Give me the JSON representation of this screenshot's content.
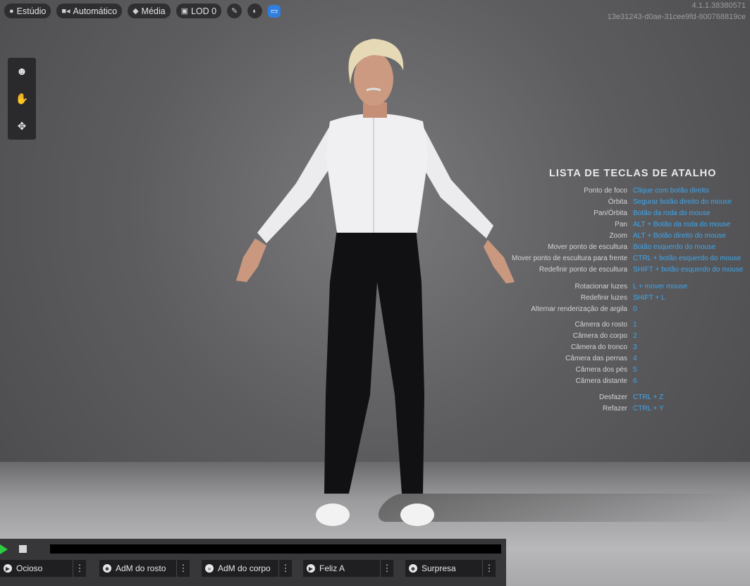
{
  "toolbar": {
    "studio": "Estúdio",
    "auto": "Automático",
    "quality": "Média",
    "lod": "LOD 0"
  },
  "version": {
    "line1": "4.1.1.38380571",
    "line2": "13e31243-d0ae-31cee9fd-800768819ce"
  },
  "shortcuts": {
    "title": "LISTA DE TECLAS DE ATALHO",
    "groups": [
      [
        {
          "label": "Ponto de foco",
          "key": "Clique com botão direito"
        },
        {
          "label": "Órbita",
          "key": "Segurar botão direito do mouse"
        },
        {
          "label": "Pan/Órbita",
          "key": "Botão da roda do mouse"
        },
        {
          "label": "Pan",
          "key": "ALT + Botão da roda do mouse"
        },
        {
          "label": "Zoom",
          "key": "ALT + Botão direito do mouse"
        },
        {
          "label": "Mover ponto de escultura",
          "key": "Botão esquerdo do mouse"
        },
        {
          "label": "Mover ponto de escultura para frente",
          "key": "CTRL + botão esquerdo do mouse"
        },
        {
          "label": "Redefinir ponto de escultura",
          "key": "SHIFT + botão esquerdo do mouse"
        }
      ],
      [
        {
          "label": "Rotacionar luzes",
          "key": "L + mover mouse"
        },
        {
          "label": "Redefinir luzes",
          "key": "SHIFT + L"
        },
        {
          "label": "Alternar renderização de argila",
          "key": "0"
        }
      ],
      [
        {
          "label": "Câmera do rosto",
          "key": "1"
        },
        {
          "label": "Câmera do corpo",
          "key": "2"
        },
        {
          "label": "Câmera do tronco",
          "key": "3"
        },
        {
          "label": "Câmera das pernas",
          "key": "4"
        },
        {
          "label": "Câmera dos pés",
          "key": "5"
        },
        {
          "label": "Câmera distante",
          "key": "6"
        }
      ],
      [
        {
          "label": "Desfazer",
          "key": "CTRL + Z"
        },
        {
          "label": "Refazer",
          "key": "CTRL + Y"
        }
      ]
    ]
  },
  "animations": [
    {
      "label": "Ocioso",
      "icon": "play-icon"
    },
    {
      "label": "AdM do rosto",
      "icon": "face-icon"
    },
    {
      "label": "AdM do corpo",
      "icon": "run-icon"
    },
    {
      "label": "Feliz A",
      "icon": "play-icon"
    },
    {
      "label": "Surpresa",
      "icon": "face-icon"
    }
  ],
  "colors": {
    "accent": "#3fa6ea",
    "play": "#2ecc40",
    "blue_button": "#2f7fe0"
  }
}
